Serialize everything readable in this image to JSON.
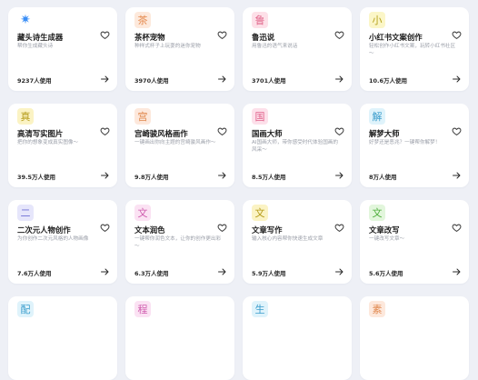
{
  "cards": [
    {
      "icon": "✷",
      "title": "藏头诗生成器",
      "desc": "帮你生成藏头诗",
      "usage": "9237人使用",
      "icon_bg": "#ffffff",
      "icon_color": "#3a8ef6",
      "icon_name": "sparkle-icon"
    },
    {
      "icon": "茶",
      "title": "茶杯宠物",
      "desc": "种样式杯子上玩耍的迷你宠物",
      "usage": "3970人使用",
      "icon_bg": "#fde9dc",
      "icon_color": "#e58a4e",
      "icon_name": "tea-char-icon"
    },
    {
      "icon": "鲁",
      "title": "鲁迅说",
      "desc": "用鲁迅的语气来说话",
      "usage": "3701人使用",
      "icon_bg": "#fde0e8",
      "icon_color": "#e0658a",
      "icon_name": "lu-char-icon"
    },
    {
      "icon": "小",
      "title": "小红书文案创作",
      "desc": "轻松创作小红书文案，玩转小红书社区～",
      "usage": "10.6万人使用",
      "icon_bg": "#fbf6c8",
      "icon_color": "#b6a21c",
      "icon_name": "xiao-char-icon"
    },
    {
      "icon": "真",
      "title": "高清写实图片",
      "desc": "把你的想象变成真实图像～",
      "usage": "39.5万人使用",
      "icon_bg": "#fbf3c4",
      "icon_color": "#b59b19",
      "icon_name": "zhen-char-icon"
    },
    {
      "icon": "宫",
      "title": "宫崎骏风格画作",
      "desc": "一键画出你向主题的宫崎骏风画作～",
      "usage": "9.8万人使用",
      "icon_bg": "#fde8dc",
      "icon_color": "#e0874d",
      "icon_name": "gong-char-icon"
    },
    {
      "icon": "国",
      "title": "国画大师",
      "desc": "AI国画大师，带你感受时代体验国画的风采～",
      "usage": "8.5万人使用",
      "icon_bg": "#fde0ea",
      "icon_color": "#e05f8a",
      "icon_name": "guo-char-icon"
    },
    {
      "icon": "解",
      "title": "解梦大师",
      "desc": "好梦还是恶兆？一键帮你解梦！",
      "usage": "8万人使用",
      "icon_bg": "#dff3fb",
      "icon_color": "#3a9dcc",
      "icon_name": "jie-char-icon"
    },
    {
      "icon": "二",
      "title": "二次元人物创作",
      "desc": "为你创作二次元风格的人物画像",
      "usage": "7.6万人使用",
      "icon_bg": "#e6e6fb",
      "icon_color": "#6f6fd6",
      "icon_name": "er-char-icon"
    },
    {
      "icon": "文",
      "title": "文本润色",
      "desc": "一键帮你润色文本，让你的创作更出彩～",
      "usage": "6.3万人使用",
      "icon_bg": "#fbe2f3",
      "icon_color": "#cf5cae",
      "icon_name": "wen-char-icon"
    },
    {
      "icon": "文",
      "title": "文章写作",
      "desc": "输入核心内容帮你快速生成文章",
      "usage": "5.9万人使用",
      "icon_bg": "#fbf3c4",
      "icon_color": "#b59b19",
      "icon_name": "wen-char-icon"
    },
    {
      "icon": "文",
      "title": "文章改写",
      "desc": "一键改写文章～",
      "usage": "5.6万人使用",
      "icon_bg": "#e2f6dc",
      "icon_color": "#4fae3d",
      "icon_name": "wen-char-icon"
    },
    {
      "icon": "配",
      "title": "",
      "desc": "",
      "usage": "",
      "icon_bg": "#dff3fb",
      "icon_color": "#3a9dcc",
      "icon_name": "pei-char-icon"
    },
    {
      "icon": "程",
      "title": "",
      "desc": "",
      "usage": "",
      "icon_bg": "#fbe2f3",
      "icon_color": "#cf5cae",
      "icon_name": "cheng-char-icon"
    },
    {
      "icon": "生",
      "title": "",
      "desc": "",
      "usage": "",
      "icon_bg": "#dff3fb",
      "icon_color": "#3a9dcc",
      "icon_name": "sheng-char-icon"
    },
    {
      "icon": "素",
      "title": "",
      "desc": "",
      "usage": "",
      "icon_bg": "#fde8dc",
      "icon_color": "#e0874d",
      "icon_name": "su-char-icon"
    }
  ]
}
